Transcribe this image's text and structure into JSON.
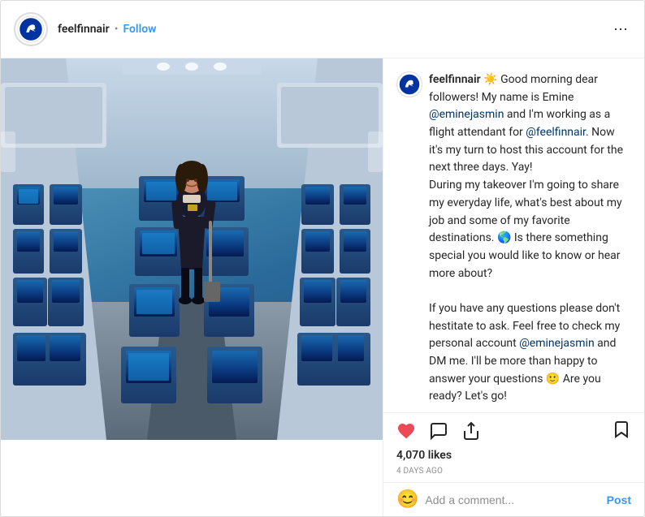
{
  "header": {
    "username": "feelfinnair",
    "verified_dot": "•",
    "follow_label": "Follow",
    "more_icon": "⋯"
  },
  "caption": {
    "username": "feelfinnair",
    "text_parts": [
      "Good morning dear followers! My name is Emine ",
      "@eminejasmin",
      " and I'm working as a flight attendant for ",
      "@feelfinnair",
      ". Now it's my turn to host this account for the next three days. Yay!\nDuring my takeover I'm going to share my everyday life, what's best about my job and some of my favorite destinations. 🌎 Is there something special you would like to know or hear more about?\n\nIf you have any questions please don't hestitate to ask. Feel free to check my personal account ",
      "@eminejasmin",
      " and DM me. I'll be more than happy to answer your questions 🙂 Are you ready? Let's go!"
    ]
  },
  "actions": {
    "like_icon": "heart",
    "comment_icon": "bubble",
    "share_icon": "share",
    "bookmark_icon": "bookmark"
  },
  "stats": {
    "likes": "4,070 likes",
    "time": "4 DAYS AGO"
  },
  "comment_input": {
    "placeholder": "Add a comment...",
    "post_label": "Post",
    "emoji": "😊"
  }
}
